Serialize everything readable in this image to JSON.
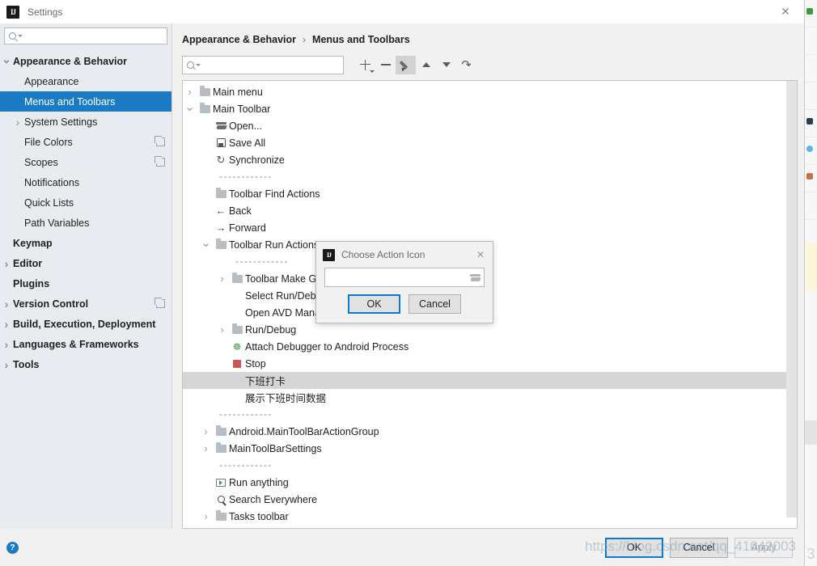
{
  "window": {
    "title": "Settings",
    "logo_text": "IJ",
    "close_icon": "✕"
  },
  "sidebar": {
    "search": {
      "value": "",
      "placeholder": ""
    },
    "items": [
      {
        "label": "Appearance & Behavior",
        "indent": 0,
        "arrow": "down",
        "bold": true,
        "selected": false,
        "copy": false
      },
      {
        "label": "Appearance",
        "indent": 1,
        "arrow": "none",
        "bold": false,
        "selected": false,
        "copy": false
      },
      {
        "label": "Menus and Toolbars",
        "indent": 1,
        "arrow": "none",
        "bold": false,
        "selected": true,
        "copy": false
      },
      {
        "label": "System Settings",
        "indent": 1,
        "arrow": "right",
        "bold": false,
        "selected": false,
        "copy": false
      },
      {
        "label": "File Colors",
        "indent": 1,
        "arrow": "none",
        "bold": false,
        "selected": false,
        "copy": true
      },
      {
        "label": "Scopes",
        "indent": 1,
        "arrow": "none",
        "bold": false,
        "selected": false,
        "copy": true
      },
      {
        "label": "Notifications",
        "indent": 1,
        "arrow": "none",
        "bold": false,
        "selected": false,
        "copy": false
      },
      {
        "label": "Quick Lists",
        "indent": 1,
        "arrow": "none",
        "bold": false,
        "selected": false,
        "copy": false
      },
      {
        "label": "Path Variables",
        "indent": 1,
        "arrow": "none",
        "bold": false,
        "selected": false,
        "copy": false
      },
      {
        "label": "Keymap",
        "indent": 0,
        "arrow": "none",
        "bold": true,
        "selected": false,
        "copy": false
      },
      {
        "label": "Editor",
        "indent": 0,
        "arrow": "right",
        "bold": true,
        "selected": false,
        "copy": false
      },
      {
        "label": "Plugins",
        "indent": 0,
        "arrow": "none",
        "bold": true,
        "selected": false,
        "copy": false
      },
      {
        "label": "Version Control",
        "indent": 0,
        "arrow": "right",
        "bold": true,
        "selected": false,
        "copy": true
      },
      {
        "label": "Build, Execution, Deployment",
        "indent": 0,
        "arrow": "right",
        "bold": true,
        "selected": false,
        "copy": false
      },
      {
        "label": "Languages & Frameworks",
        "indent": 0,
        "arrow": "right",
        "bold": true,
        "selected": false,
        "copy": false
      },
      {
        "label": "Tools",
        "indent": 0,
        "arrow": "right",
        "bold": true,
        "selected": false,
        "copy": false
      }
    ]
  },
  "breadcrumb": {
    "parent": "Appearance & Behavior",
    "separator": "›",
    "current": "Menus and Toolbars"
  },
  "toolbar": {
    "search": {
      "value": "",
      "placeholder": ""
    },
    "buttons": [
      {
        "name": "add",
        "glyph": "+"
      },
      {
        "name": "remove",
        "glyph": "−"
      },
      {
        "name": "edit",
        "glyph": "pencil"
      },
      {
        "name": "move-up",
        "glyph": "▲"
      },
      {
        "name": "move-down",
        "glyph": "▼"
      },
      {
        "name": "revert",
        "glyph": "↺"
      }
    ]
  },
  "tree": {
    "rows": [
      {
        "label": "Main menu",
        "indent": 0,
        "arrow": "right",
        "icon": "folder",
        "sel": false
      },
      {
        "label": "Main Toolbar",
        "indent": 0,
        "arrow": "down",
        "icon": "folder",
        "sel": false
      },
      {
        "label": "Open...",
        "indent": 1,
        "arrow": "none",
        "icon": "openfolder",
        "sel": false
      },
      {
        "label": "Save All",
        "indent": 1,
        "arrow": "none",
        "icon": "save",
        "sel": false
      },
      {
        "label": "Synchronize",
        "indent": 1,
        "arrow": "none",
        "icon": "sync",
        "sel": false
      },
      {
        "label": "------------",
        "indent": 1,
        "arrow": "none",
        "icon": "none",
        "sel": false,
        "sep": true
      },
      {
        "label": "Toolbar Find Actions",
        "indent": 1,
        "arrow": "none",
        "icon": "folder",
        "sel": false
      },
      {
        "label": "Back",
        "indent": 1,
        "arrow": "none",
        "icon": "back",
        "sel": false
      },
      {
        "label": "Forward",
        "indent": 1,
        "arrow": "none",
        "icon": "forward",
        "sel": false
      },
      {
        "label": "Toolbar Run Actions",
        "indent": 1,
        "arrow": "down",
        "icon": "folder",
        "sel": false
      },
      {
        "label": "------------",
        "indent": 2,
        "arrow": "none",
        "icon": "none",
        "sel": false,
        "sep": true
      },
      {
        "label": "Toolbar Make Group",
        "indent": 2,
        "arrow": "right",
        "icon": "folder",
        "sel": false
      },
      {
        "label": "Select Run/Debug Configuration",
        "indent": 2,
        "arrow": "none",
        "icon": "none",
        "sel": false
      },
      {
        "label": "Open AVD Manager",
        "indent": 2,
        "arrow": "none",
        "icon": "none",
        "sel": false
      },
      {
        "label": "Run/Debug",
        "indent": 2,
        "arrow": "right",
        "icon": "folder",
        "sel": false
      },
      {
        "label": "Attach Debugger to Android Process",
        "indent": 2,
        "arrow": "none",
        "icon": "bug",
        "sel": false
      },
      {
        "label": "Stop",
        "indent": 2,
        "arrow": "none",
        "icon": "stop",
        "sel": false
      },
      {
        "label": "下班打卡",
        "indent": 2,
        "arrow": "none",
        "icon": "none",
        "sel": true
      },
      {
        "label": "展示下班时间数据",
        "indent": 2,
        "arrow": "none",
        "icon": "none",
        "sel": false
      },
      {
        "label": "------------",
        "indent": 1,
        "arrow": "none",
        "icon": "none",
        "sel": false,
        "sep": true
      },
      {
        "label": "Android.MainToolBarActionGroup",
        "indent": 1,
        "arrow": "right",
        "icon": "folder",
        "sel": false
      },
      {
        "label": "MainToolBarSettings",
        "indent": 1,
        "arrow": "right",
        "icon": "folder",
        "sel": false
      },
      {
        "label": "------------",
        "indent": 1,
        "arrow": "none",
        "icon": "none",
        "sel": false,
        "sep": true
      },
      {
        "label": "Run anything",
        "indent": 1,
        "arrow": "none",
        "icon": "run",
        "sel": false
      },
      {
        "label": "Search Everywhere",
        "indent": 1,
        "arrow": "none",
        "icon": "search",
        "sel": false
      },
      {
        "label": "Tasks toolbar",
        "indent": 1,
        "arrow": "right",
        "icon": "folder",
        "sel": false
      }
    ]
  },
  "footer": {
    "help_icon": "?",
    "ok": "OK",
    "cancel": "Cancel",
    "apply": "Apply",
    "watermark": "https://blog.csdn.net/qq_41042003"
  },
  "dialog": {
    "title": "Choose Action Icon",
    "logo_text": "IJ",
    "close_icon": "✕",
    "path": {
      "value": "",
      "placeholder": ""
    },
    "browse_icon": "folder-icon",
    "ok": "OK",
    "cancel": "Cancel"
  },
  "colors": {
    "accent": "#1a7bc4",
    "selection_sidebar": "#1a7bc4",
    "selection_tree": "#d6d6d6",
    "focus_border": "#0a7bd4",
    "stop_red": "#d05555",
    "run_green": "#3c9a3c"
  }
}
